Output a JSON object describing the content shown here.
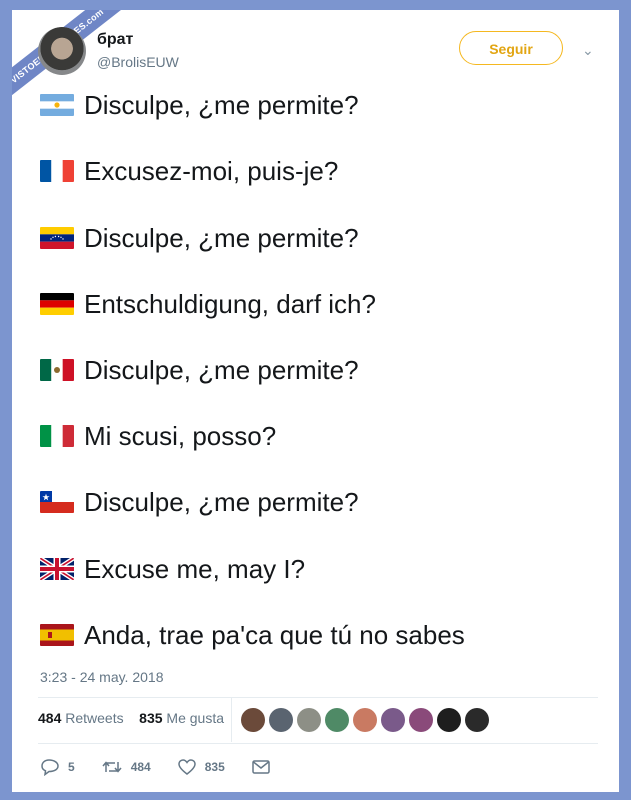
{
  "watermark": "VISTOENLASREDES.com",
  "tweet": {
    "display_name": "брат",
    "handle": "@BrolisEUW",
    "follow_label": "Seguir",
    "lines": [
      {
        "flag": "argentina",
        "text": "Disculpe, ¿me permite?"
      },
      {
        "flag": "france",
        "text": "Excusez-moi, puis-je?"
      },
      {
        "flag": "venezuela",
        "text": "Disculpe, ¿me permite?"
      },
      {
        "flag": "germany",
        "text": "Entschuldigung, darf ich?"
      },
      {
        "flag": "mexico",
        "text": "Disculpe, ¿me permite?"
      },
      {
        "flag": "italy",
        "text": "Mi scusi, posso?"
      },
      {
        "flag": "chile",
        "text": "Disculpe, ¿me permite?"
      },
      {
        "flag": "united-kingdom",
        "text": "Excuse me, may I?"
      },
      {
        "flag": "spain",
        "text": "Anda, trae pa'ca que tú no sabes"
      }
    ],
    "timestamp": "3:23 - 24 may. 2018",
    "retweets_count": "484",
    "retweets_label": "Retweets",
    "likes_count": "835",
    "likes_label": "Me gusta",
    "reply_count": "5",
    "retweet_action_count": "484",
    "like_action_count": "835"
  }
}
